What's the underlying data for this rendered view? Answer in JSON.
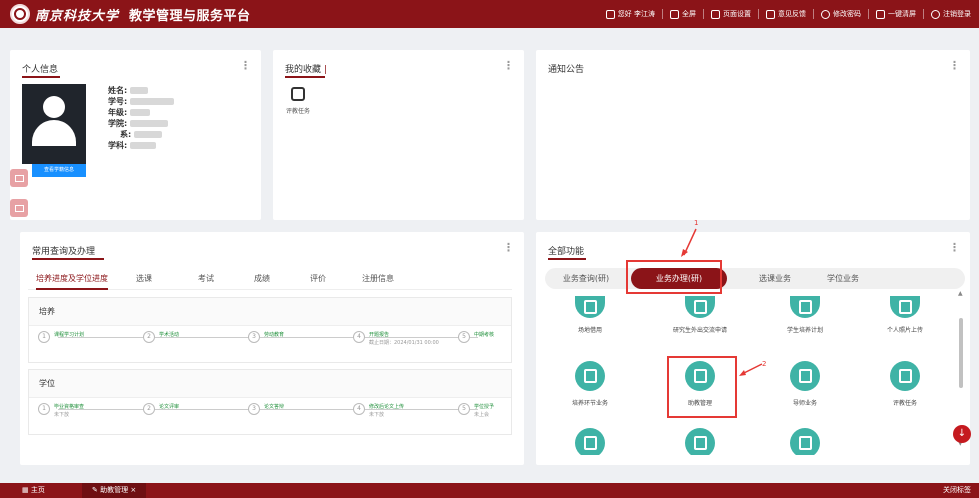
{
  "header": {
    "university": "南京科技大学",
    "platform": "教学管理与服务平台",
    "nav": [
      {
        "icon": "user-icon",
        "label": "您好 李江涛"
      },
      {
        "icon": "fullscreen-icon",
        "label": "全屏"
      },
      {
        "icon": "home-icon",
        "label": "页面设置"
      },
      {
        "icon": "feedback-icon",
        "label": "意见反馈"
      },
      {
        "icon": "lock-icon",
        "label": "修改密码"
      },
      {
        "icon": "clean-icon",
        "label": "一键清屏"
      },
      {
        "icon": "power-icon",
        "label": "注销登录"
      }
    ]
  },
  "personal": {
    "title": "个人信息",
    "fields": [
      "姓名:",
      "学号:",
      "年级:",
      "学院:",
      "系:",
      "学科:"
    ],
    "view_more": "查看学籍信息"
  },
  "favorites": {
    "title": "我的收藏",
    "divider": "|",
    "items": [
      {
        "label": "评教任务"
      }
    ]
  },
  "notice": {
    "title": "通知公告"
  },
  "common": {
    "title": "常用查询及办理",
    "tabs": [
      "培养进度及学位进度",
      "选课",
      "考试",
      "成绩",
      "评价",
      "注册信息"
    ],
    "training": {
      "title": "培养",
      "steps": [
        {
          "num": "1",
          "label": "课程学习计划",
          "sub": ""
        },
        {
          "num": "2",
          "label": "学术活动",
          "sub": ""
        },
        {
          "num": "3",
          "label": "劳动教育",
          "sub": ""
        },
        {
          "num": "4",
          "label": "开题报告",
          "sub": "截止日期：2024/01/31 00:00"
        },
        {
          "num": "5",
          "label": "中期考核",
          "sub": ""
        }
      ]
    },
    "degree": {
      "title": "学位",
      "steps": [
        {
          "num": "1",
          "label": "毕业資格审查",
          "sub": "未下放"
        },
        {
          "num": "2",
          "label": "论文评审",
          "sub": ""
        },
        {
          "num": "3",
          "label": "论文答辩",
          "sub": ""
        },
        {
          "num": "4",
          "label": "修改后论文上传",
          "sub": "未下放"
        },
        {
          "num": "5",
          "label": "学位授予",
          "sub": "未上会"
        }
      ]
    }
  },
  "functions": {
    "title": "全部功能",
    "tabs": [
      "业务查询(研)",
      "业务办理(研)",
      "选课业务",
      "学位业务"
    ],
    "items": [
      "场地借用",
      "研究生外出交流申请",
      "学生培养计划",
      "个人照片上传",
      "培养环节业务",
      "助教管理",
      "导师业务",
      "评教任务"
    ],
    "annotation_1": "1",
    "annotation_2": "2"
  },
  "taskbar": {
    "home": "主页",
    "tab": "助教管理",
    "close_tab": "×",
    "close_tabs": "关闭标签"
  },
  "colors": {
    "brand": "#8b1418",
    "accent": "#3fb3a6",
    "annotation": "#e53935",
    "link": "#1890ff"
  }
}
